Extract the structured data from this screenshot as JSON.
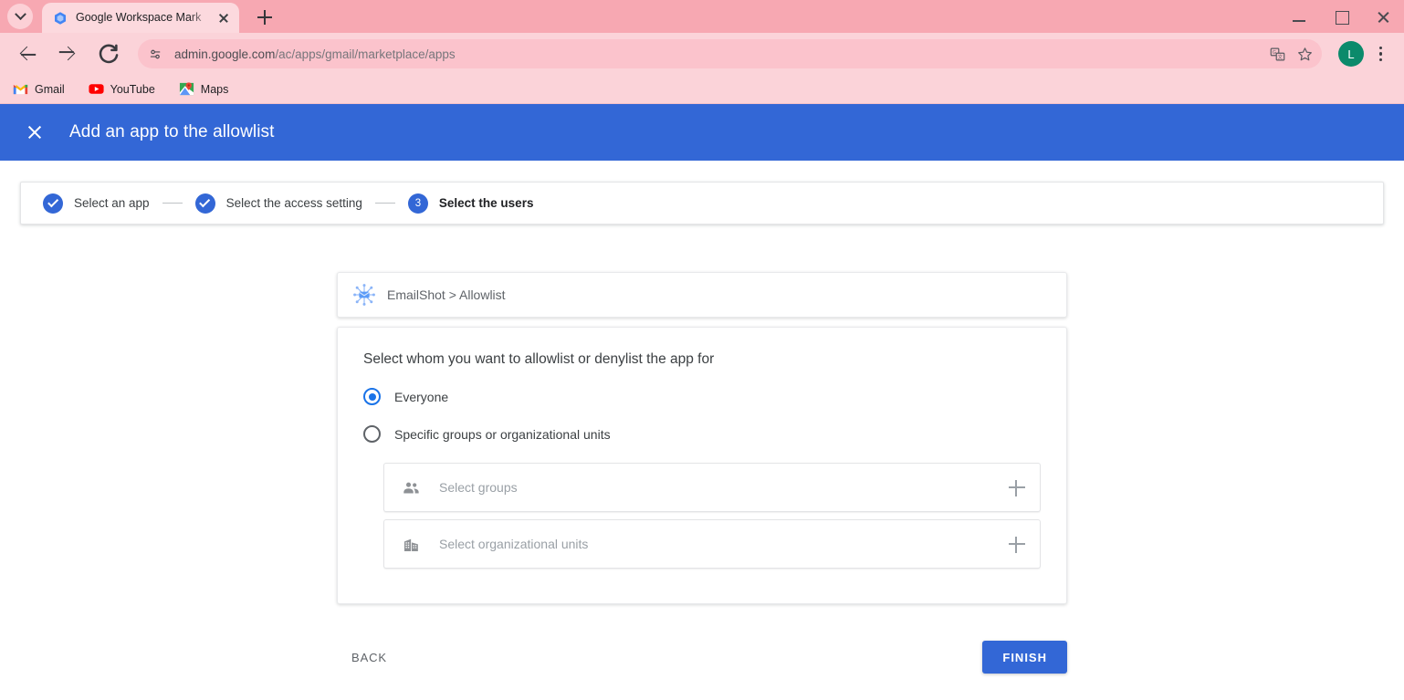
{
  "browser": {
    "tab": {
      "title": "Google Workspace Mark",
      "favicon_icon": "google-cloud-icon",
      "close_icon": "close-icon"
    },
    "tab_search_icon": "chevron-down-icon",
    "new_tab_icon": "plus-icon",
    "window_controls": {
      "minimize_icon": "minimize-icon",
      "maximize_icon": "maximize-icon",
      "close_icon": "close-icon"
    },
    "nav": {
      "back_icon": "arrow-left-icon",
      "forward_icon": "arrow-right-icon",
      "reload_icon": "reload-icon"
    },
    "omnibox": {
      "site_info_icon": "page-info-icon",
      "url_host": "admin.google.com",
      "url_path": "/ac/apps/gmail/marketplace/apps",
      "translate_icon": "translate-icon",
      "bookmark_icon": "star-icon"
    },
    "profile": {
      "initial": "L",
      "color": "#0b8a6b"
    },
    "menu_icon": "kebab-menu-icon",
    "bookmarks": [
      {
        "label": "Gmail",
        "icon": "gmail-icon"
      },
      {
        "label": "YouTube",
        "icon": "youtube-icon"
      },
      {
        "label": "Maps",
        "icon": "maps-icon"
      }
    ]
  },
  "appbar": {
    "close_icon": "close-icon",
    "title": "Add an app to the allowlist",
    "color": "#3367d6"
  },
  "stepper": {
    "steps": [
      {
        "marker": "check",
        "label": "Select an app",
        "state": "complete"
      },
      {
        "marker": "check",
        "label": "Select the access setting",
        "state": "complete"
      },
      {
        "marker": "3",
        "label": "Select the users",
        "state": "active"
      }
    ]
  },
  "app_chip": {
    "icon": "emailshot-network-icon",
    "text": "EmailShot > Allowlist"
  },
  "panel": {
    "title": "Select whom you want to allowlist or denylist the app for",
    "options": [
      {
        "label": "Everyone",
        "selected": true
      },
      {
        "label": "Specific groups or organizational units",
        "selected": false
      }
    ],
    "fields": [
      {
        "icon": "people-icon",
        "placeholder": "Select groups",
        "add_icon": "plus-icon"
      },
      {
        "icon": "building-icon",
        "placeholder": "Select organizational units",
        "add_icon": "plus-icon"
      }
    ]
  },
  "footer": {
    "back_label": "BACK",
    "finish_label": "FINISH"
  }
}
